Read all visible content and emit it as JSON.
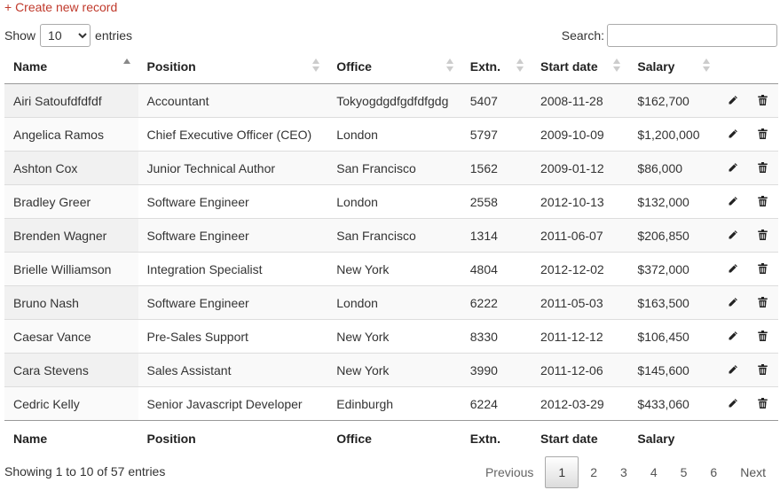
{
  "create_link": "+ Create new record",
  "length": {
    "prefix": "Show",
    "value": "10",
    "options": [
      "10"
    ],
    "suffix": "entries"
  },
  "search": {
    "label": "Search:",
    "value": "",
    "placeholder": ""
  },
  "columns": [
    "Name",
    "Position",
    "Office",
    "Extn.",
    "Start date",
    "Salary"
  ],
  "sort": {
    "column": "Name",
    "direction": "ascending"
  },
  "rows": [
    [
      "Airi Satoufdfdfdf",
      "Accountant",
      "Tokyogdgdfgdfdfgdg",
      "5407",
      "2008-11-28",
      "$162,700"
    ],
    [
      "Angelica Ramos",
      "Chief Executive Officer (CEO)",
      "London",
      "5797",
      "2009-10-09",
      "$1,200,000"
    ],
    [
      "Ashton Cox",
      "Junior Technical Author",
      "San Francisco",
      "1562",
      "2009-01-12",
      "$86,000"
    ],
    [
      "Bradley Greer",
      "Software Engineer",
      "London",
      "2558",
      "2012-10-13",
      "$132,000"
    ],
    [
      "Brenden Wagner",
      "Software Engineer",
      "San Francisco",
      "1314",
      "2011-06-07",
      "$206,850"
    ],
    [
      "Brielle Williamson",
      "Integration Specialist",
      "New York",
      "4804",
      "2012-12-02",
      "$372,000"
    ],
    [
      "Bruno Nash",
      "Software Engineer",
      "London",
      "6222",
      "2011-05-03",
      "$163,500"
    ],
    [
      "Caesar Vance",
      "Pre-Sales Support",
      "New York",
      "8330",
      "2011-12-12",
      "$106,450"
    ],
    [
      "Cara Stevens",
      "Sales Assistant",
      "New York",
      "3990",
      "2011-12-06",
      "$145,600"
    ],
    [
      "Cedric Kelly",
      "Senior Javascript Developer",
      "Edinburgh",
      "6224",
      "2012-03-29",
      "$433,060"
    ]
  ],
  "row_actions": [
    "pencil-icon",
    "trash-icon"
  ],
  "info": "Showing 1 to 10 of 57 entries",
  "pagination": {
    "previous": "Previous",
    "pages": [
      "1",
      "2",
      "3",
      "4",
      "5",
      "6"
    ],
    "current": "1",
    "next": "Next"
  },
  "colors": {
    "link": "#c0392b",
    "odd_row": "#f9f9f9",
    "sorted_col": "#f1f1f1"
  }
}
